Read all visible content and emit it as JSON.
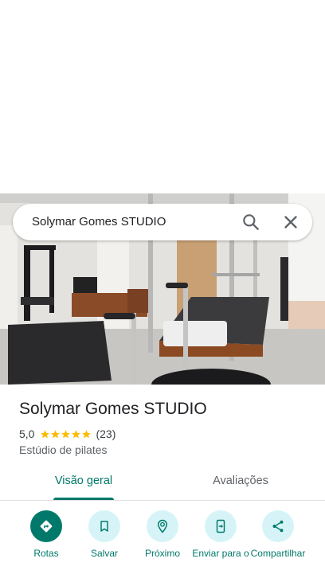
{
  "search": {
    "query": "Solymar Gomes STUDIO"
  },
  "place": {
    "name": "Solymar Gomes STUDIO",
    "rating": "5,0",
    "rating_value": 5.0,
    "review_count": "(23)",
    "category": "Estúdio de pilates"
  },
  "tabs": [
    {
      "label": "Visão geral",
      "selected": true
    },
    {
      "label": "Avaliações",
      "selected": false
    }
  ],
  "actions": [
    {
      "label": "Rotas",
      "icon": "directions-icon"
    },
    {
      "label": "Salvar",
      "icon": "bookmark-icon"
    },
    {
      "label": "Próximo",
      "icon": "nearby-icon"
    },
    {
      "label": "Enviar para o",
      "icon": "send-to-phone-icon"
    },
    {
      "label": "Compartilhar",
      "icon": "share-icon"
    }
  ],
  "colors": {
    "accent": "#00796b",
    "action_bg": "#d6f4f8",
    "star": "#fbbc04"
  }
}
